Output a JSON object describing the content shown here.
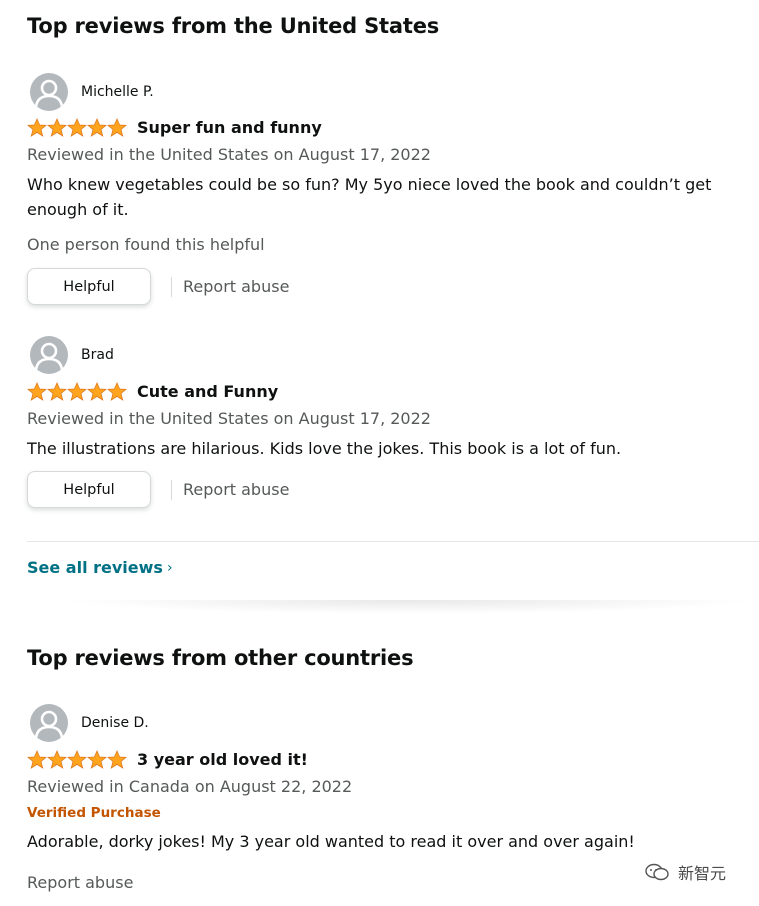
{
  "sections": {
    "us_title": "Top reviews from the United States",
    "other_title": "Top reviews from other countries"
  },
  "rating_color": "#ffa41c",
  "reviews": [
    {
      "author": "Michelle P.",
      "stars": 5,
      "title": "Super fun and funny",
      "date": "Reviewed in the United States on August 17, 2022",
      "body": "Who knew vegetables could be so fun? My 5yo niece loved the book and couldn’t get enough of it.",
      "helpful_count": "One person found this helpful",
      "helpful_label": "Helpful",
      "report_label": "Report abuse"
    },
    {
      "author": "Brad",
      "stars": 5,
      "title": "Cute and Funny",
      "date": "Reviewed in the United States on August 17, 2022",
      "body": "The illustrations are hilarious. Kids love the jokes. This book is a lot of fun.",
      "helpful_label": "Helpful",
      "report_label": "Report abuse"
    },
    {
      "author": "Denise D.",
      "stars": 5,
      "title": "3 year old loved it!",
      "date": "Reviewed in Canada on August 22, 2022",
      "verified": "Verified Purchase",
      "body": "Adorable, dorky jokes! My 3 year old wanted to read it over and over again!",
      "report_label": "Report abuse"
    }
  ],
  "see_all": "See all reviews",
  "chevron_icon": "chevron-right-icon",
  "watermark_text": "新智元",
  "link_color": "#007185",
  "verified_color": "#c45500"
}
